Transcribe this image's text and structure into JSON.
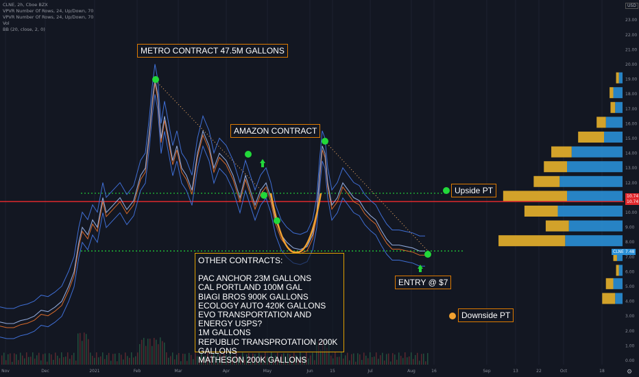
{
  "header": {
    "symbol_line": "CLNE, 2h, Cboe BZX",
    "indicators": [
      "VPVR Number Of Rows, 24, Up/Down, 70",
      "VPVR Number Of Rows, 24, Up/Down, 70",
      "Vol",
      "BB (20, close, 2, 0)"
    ],
    "currency": "USD"
  },
  "annotations": {
    "metro": "METRO CONTRACT 47.5M GALLONS",
    "amazon": "AMAZON CONTRACT",
    "upside": "Upside PT",
    "entry": "ENTRY @ $7",
    "downside": "Downside PT"
  },
  "contracts": {
    "title": "OTHER CONTRACTS:",
    "items": [
      "PAC ANCHOR 23M GALLONS",
      "CAL PORTLAND 100M GAL",
      "BIAGI BROS 900K GALLONS",
      "ECOLOGY AUTO 420K GALLONS",
      "EVO TRANSPORTATION AND ENERGY USPS?",
      "1M GALLONS",
      "REPUBLIC TRANSPROTATION 200K GALLONS",
      "MATHESON 200K GALLONS"
    ]
  },
  "price_tags": {
    "red_1": "10.74",
    "red_2": "10.74",
    "last_symbol": "CLNE",
    "last_value": "7.48"
  },
  "colors": {
    "background": "#131722",
    "red_line": "#e0292d",
    "green_dots": "#22d83a",
    "vp_up": "#2a8fd6",
    "vp_down": "#e8b12b",
    "bands": "#3f6fd6",
    "orange": "#f0a030"
  },
  "chart_data": {
    "type": "line",
    "title": "CLNE, 2h, Cboe BZX",
    "x_ticks": [
      "Nov",
      "Dec",
      "2021",
      "Feb",
      "Mar",
      "Apr",
      "May",
      "Jun",
      "15",
      "Jul",
      "Aug",
      "16",
      "Sep",
      "13",
      "22",
      "Oct",
      "18"
    ],
    "y_ticks": [
      "0.00",
      "1.00",
      "2.00",
      "3.00",
      "4.00",
      "5.00",
      "6.00",
      "7.00",
      "8.00",
      "9.00",
      "10.00",
      "11.00",
      "12.00",
      "13.00",
      "14.00",
      "15.00",
      "16.00",
      "17.00",
      "18.00",
      "19.00",
      "20.00",
      "21.00",
      "22.00",
      "23.00"
    ],
    "ylim": [
      0,
      24
    ],
    "price_series": [
      [
        0,
        2.6
      ],
      [
        10,
        2.5
      ],
      [
        20,
        2.5
      ],
      [
        30,
        2.7
      ],
      [
        40,
        2.8
      ],
      [
        50,
        3.0
      ],
      [
        60,
        3.4
      ],
      [
        70,
        3.3
      ],
      [
        80,
        3.6
      ],
      [
        90,
        4.0
      ],
      [
        100,
        5.0
      ],
      [
        108,
        6.0
      ],
      [
        115,
        8.0
      ],
      [
        120,
        9.0
      ],
      [
        128,
        8.5
      ],
      [
        135,
        9.5
      ],
      [
        142,
        9.0
      ],
      [
        150,
        11.0
      ],
      [
        155,
        10.0
      ],
      [
        165,
        10.5
      ],
      [
        175,
        11.0
      ],
      [
        185,
        10.2
      ],
      [
        195,
        10.8
      ],
      [
        205,
        12.5
      ],
      [
        212,
        13.0
      ],
      [
        218,
        15.5
      ],
      [
        222,
        17.5
      ],
      [
        226,
        19.0
      ],
      [
        230,
        18.0
      ],
      [
        235,
        15.0
      ],
      [
        240,
        16.5
      ],
      [
        246,
        15.0
      ],
      [
        252,
        13.5
      ],
      [
        258,
        14.5
      ],
      [
        265,
        13.0
      ],
      [
        272,
        12.5
      ],
      [
        280,
        11.5
      ],
      [
        288,
        14.0
      ],
      [
        296,
        15.5
      ],
      [
        305,
        14.5
      ],
      [
        312,
        13.0
      ],
      [
        320,
        14.0
      ],
      [
        330,
        13.5
      ],
      [
        340,
        12.5
      ],
      [
        350,
        11.0
      ],
      [
        358,
        12.5
      ],
      [
        365,
        11.5
      ],
      [
        372,
        10.5
      ],
      [
        380,
        11.5
      ],
      [
        388,
        12.0
      ],
      [
        395,
        11.0
      ],
      [
        402,
        9.5
      ],
      [
        410,
        8.5
      ],
      [
        418,
        8.0
      ],
      [
        428,
        7.6
      ],
      [
        438,
        7.5
      ],
      [
        448,
        7.7
      ],
      [
        456,
        8.5
      ],
      [
        462,
        10.0
      ],
      [
        466,
        12.5
      ],
      [
        470,
        14.5
      ],
      [
        474,
        14.0
      ],
      [
        478,
        12.0
      ],
      [
        484,
        10.5
      ],
      [
        492,
        11.0
      ],
      [
        500,
        12.0
      ],
      [
        508,
        11.5
      ],
      [
        516,
        11.0
      ],
      [
        524,
        10.8
      ],
      [
        532,
        10.2
      ],
      [
        540,
        9.8
      ],
      [
        548,
        9.5
      ],
      [
        556,
        8.8
      ],
      [
        564,
        8.2
      ],
      [
        572,
        7.8
      ],
      [
        582,
        7.8
      ],
      [
        592,
        7.7
      ],
      [
        602,
        7.6
      ],
      [
        612,
        7.4
      ],
      [
        620,
        7.4
      ]
    ],
    "horizontal_levels": {
      "upside_pt": 11.3,
      "red_line": 10.74,
      "entry_level": 7.4
    },
    "last_price": 7.48,
    "trendlines": [
      {
        "from": [
          "Feb",
          18.9
        ],
        "to": [
          "Apr",
          11.3
        ]
      },
      {
        "from": [
          "Jun",
          14.8
        ],
        "to": [
          "Aug",
          7.4
        ]
      }
    ],
    "volume_profile": [
      {
        "price": 2.6,
        "up": 0,
        "down": 0
      },
      {
        "price": 4.1,
        "up": 8,
        "down": 14
      },
      {
        "price": 5.1,
        "up": 10,
        "down": 8
      },
      {
        "price": 6.0,
        "up": 4,
        "down": 3
      },
      {
        "price": 7.0,
        "up": 6,
        "down": 4
      },
      {
        "price": 8.0,
        "up": 62,
        "down": 72
      },
      {
        "price": 9.0,
        "up": 58,
        "down": 25
      },
      {
        "price": 10.0,
        "up": 70,
        "down": 36
      },
      {
        "price": 11.0,
        "up": 60,
        "down": 69
      },
      {
        "price": 12.0,
        "up": 68,
        "down": 28
      },
      {
        "price": 13.0,
        "up": 60,
        "down": 25
      },
      {
        "price": 14.0,
        "up": 55,
        "down": 22
      },
      {
        "price": 15.0,
        "up": 20,
        "down": 28
      },
      {
        "price": 16.0,
        "up": 18,
        "down": 10
      },
      {
        "price": 17.0,
        "up": 8,
        "down": 5
      },
      {
        "price": 18.0,
        "up": 10,
        "down": 4
      },
      {
        "price": 19.0,
        "up": 4,
        "down": 3
      }
    ]
  }
}
